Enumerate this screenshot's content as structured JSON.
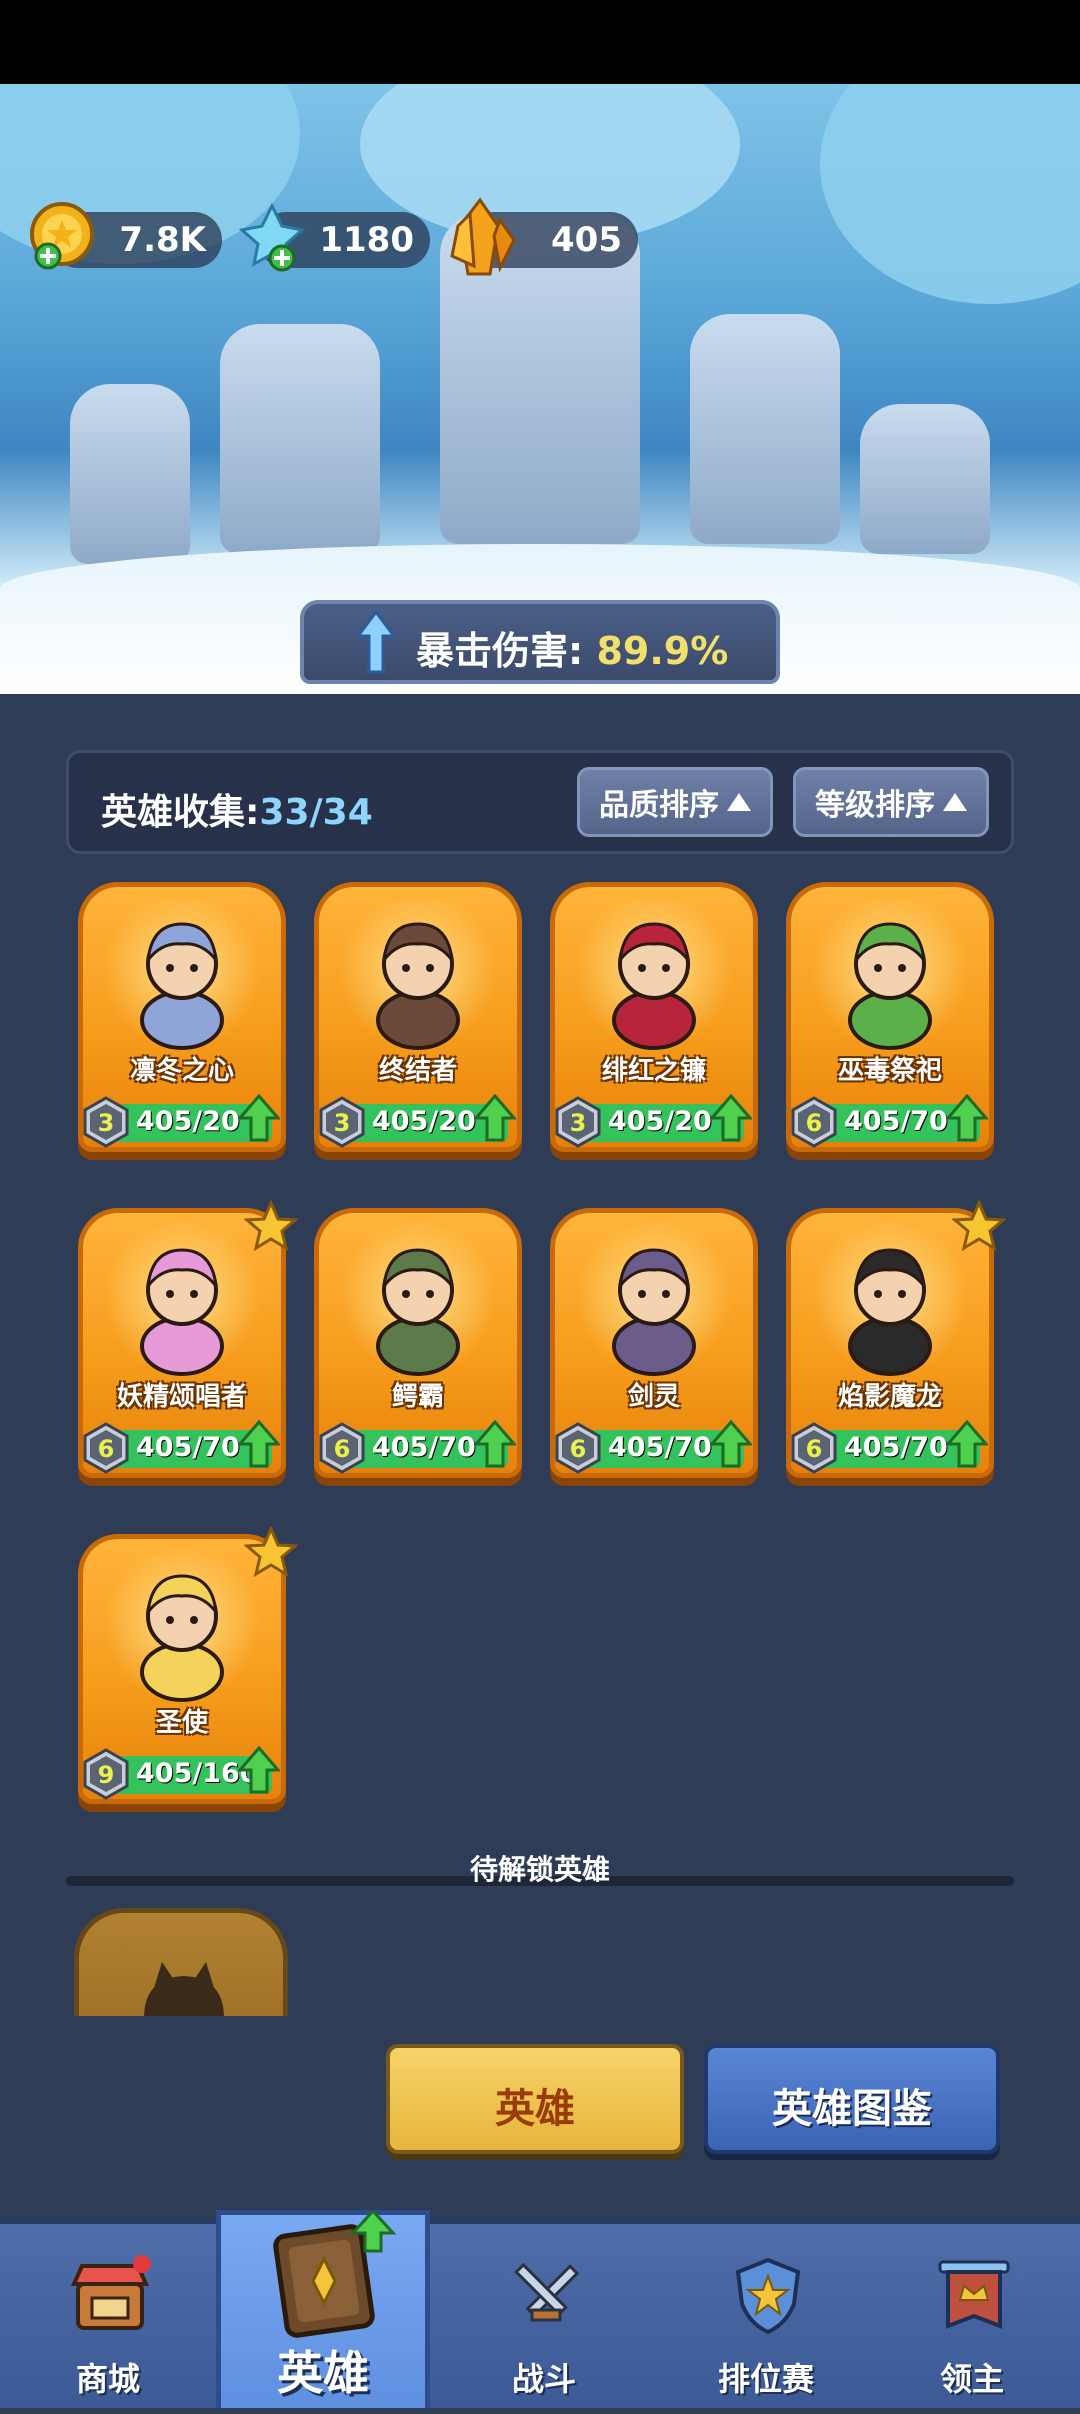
{
  "currency": {
    "gold": "7.8K",
    "crystal": "1180",
    "shard": "405"
  },
  "banner": {
    "label": "暴击伤害:",
    "value": "89.9%"
  },
  "collection": {
    "label": "英雄收集:",
    "count": "33/34",
    "sort_quality": "品质排序",
    "sort_level": "等级排序"
  },
  "heroes": [
    {
      "name": "凛冬之心",
      "level": "3",
      "progress": "405/20",
      "star": false
    },
    {
      "name": "终结者",
      "level": "3",
      "progress": "405/20",
      "star": false
    },
    {
      "name": "绯红之镰",
      "level": "3",
      "progress": "405/20",
      "star": false
    },
    {
      "name": "巫毒祭祀",
      "level": "6",
      "progress": "405/70",
      "star": false
    },
    {
      "name": "妖精颂唱者",
      "level": "6",
      "progress": "405/70",
      "star": true
    },
    {
      "name": "鳄霸",
      "level": "6",
      "progress": "405/70",
      "star": false
    },
    {
      "name": "剑灵",
      "level": "6",
      "progress": "405/70",
      "star": false
    },
    {
      "name": "焰影魔龙",
      "level": "6",
      "progress": "405/70",
      "star": true
    },
    {
      "name": "圣使",
      "level": "9",
      "progress": "405/160",
      "star": true
    }
  ],
  "locked_section": {
    "title": "待解锁英雄"
  },
  "buttons": {
    "hero": "英雄",
    "codex": "英雄图鉴"
  },
  "nav": {
    "shop": "商城",
    "hero": "英雄",
    "battle": "战斗",
    "ranked": "排位赛",
    "lord": "领主"
  }
}
